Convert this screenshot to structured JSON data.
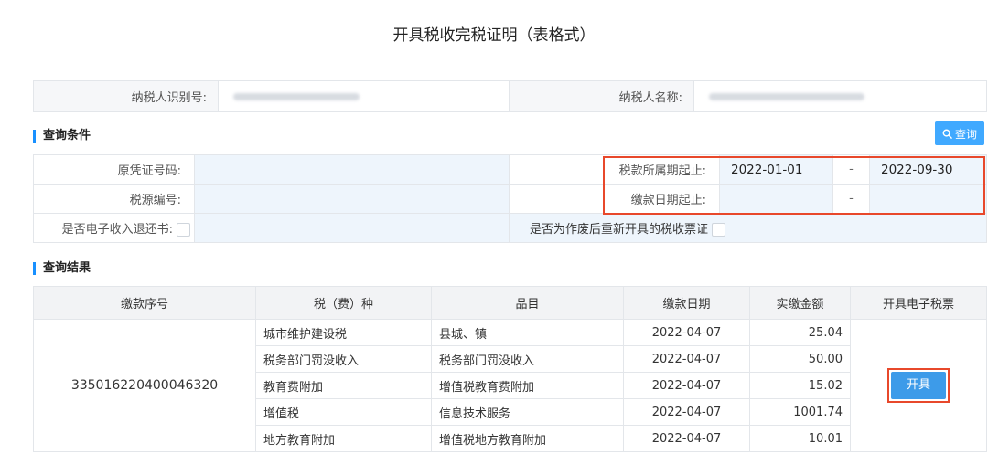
{
  "page": {
    "title": "开具税收完税证明（表格式）"
  },
  "taxpayer": {
    "id_label": "纳税人识别号:",
    "name_label": "纳税人名称:"
  },
  "query": {
    "section_title": "查询条件",
    "button_label": "查询",
    "original_voucher_label": "原凭证号码:",
    "tax_source_label": "税源编号:",
    "e_refund_label": "是否电子收入退还书:",
    "tax_period_label": "税款所属期起止:",
    "tax_period_start": "2022-01-01",
    "tax_period_end": "2022-09-30",
    "pay_date_label": "缴款日期起止:",
    "pay_date_start": "",
    "pay_date_end": "",
    "range_sep": "-",
    "reissue_label": "是否为作废后重新开具的税收票证"
  },
  "results": {
    "section_title": "查询结果",
    "headers": [
      "缴款序号",
      "税（费）种",
      "品目",
      "缴款日期",
      "实缴金额",
      "开具电子税票"
    ],
    "payment_no": "335016220400046320",
    "action_label": "开具",
    "rows": [
      {
        "tax_type": "城市维护建设税",
        "item": "县城、镇",
        "date": "2022-04-07",
        "amount": "25.04"
      },
      {
        "tax_type": "税务部门罚没收入",
        "item": "税务部门罚没收入",
        "date": "2022-04-07",
        "amount": "50.00"
      },
      {
        "tax_type": "教育费附加",
        "item": "增值税教育费附加",
        "date": "2022-04-07",
        "amount": "15.02"
      },
      {
        "tax_type": "增值税",
        "item": "信息技术服务",
        "date": "2022-04-07",
        "amount": "1001.74"
      },
      {
        "tax_type": "地方教育附加",
        "item": "增值税地方教育附加",
        "date": "2022-04-07",
        "amount": "10.01"
      }
    ]
  },
  "colors": {
    "accent": "#1890ff",
    "button": "#40a9ff",
    "highlight": "#e8482b"
  },
  "icons": {
    "query_button": "search-icon"
  }
}
